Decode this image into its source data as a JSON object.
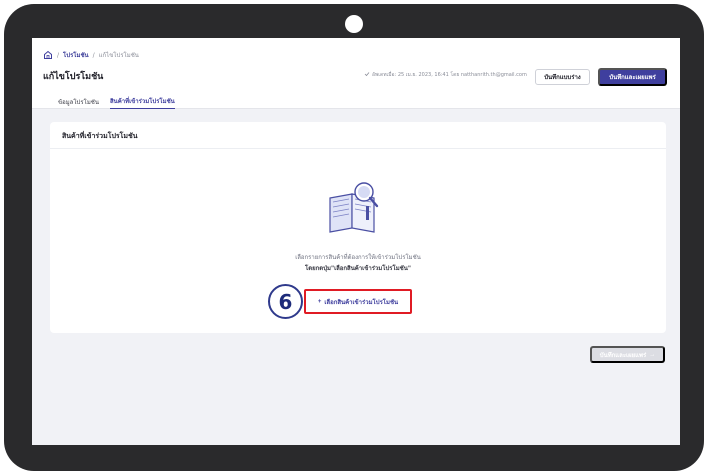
{
  "breadcrumb": {
    "root": "โปรโมชัน",
    "current": "แก้ไขโปรโมชัน",
    "separator": "/"
  },
  "header": {
    "title": "แก้ไขโปรโมชัน",
    "save_status": "อัพเดทเมื่อ: 25 เม.ย. 2023, 16:41 โดย natthanrith.th@gmail.com",
    "draft_button": "บันทึกแบบร่าง",
    "publish_button": "บันทึกและเผยแพร่"
  },
  "tabs": [
    {
      "label": "ข้อมูลโปรโมชัน",
      "active": false
    },
    {
      "label": "สินค้าที่เข้าร่วมโปรโมชัน",
      "active": true
    }
  ],
  "card": {
    "title": "สินค้าที่เข้าร่วมโปรโมชัน",
    "empty_line1": "เลือกรายการสินค้าที่ต้องการให้เข้าร่วมโปรโมชัน",
    "empty_line2": "โดยกดปุ่ม\"เลือกสินค้าเข้าร่วมโปรโมชัน\"",
    "add_button_icon": "+",
    "add_button_label": "เลือกสินค้าเข้าร่วมโปรโมชัน"
  },
  "annotation": {
    "step_number": "6",
    "highlight_color": "#e01b24",
    "badge_color": "#2f3a8c"
  },
  "footer": {
    "publish_button": "บันทึกและเผยแพร่",
    "arrow_icon": "→"
  },
  "colors": {
    "primary": "#3f3f9e",
    "background": "#f1f2f6"
  }
}
